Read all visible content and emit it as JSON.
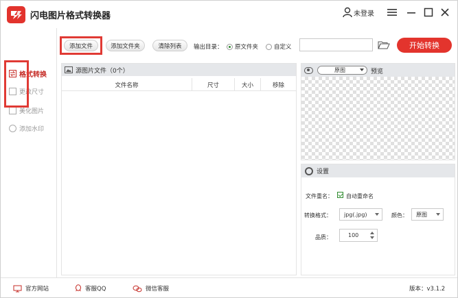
{
  "app": {
    "title": "闪电图片格式转换器",
    "user_label": "未登录"
  },
  "sidebar": {
    "items": [
      {
        "label": "格式转换",
        "icon": "convert-icon",
        "active": true
      },
      {
        "label": "更改尺寸",
        "icon": "resize-icon",
        "active": false
      },
      {
        "label": "美化图片",
        "icon": "beautify-icon",
        "active": false
      },
      {
        "label": "添加水印",
        "icon": "watermark-icon",
        "active": false
      }
    ]
  },
  "toolbar": {
    "add_file": "添加文件",
    "add_folder": "添加文件夹",
    "clear_list": "清除列表",
    "output_label": "输出目录：",
    "radio_source": "原文件夹",
    "radio_custom": "自定义",
    "output_path": "",
    "start": "开始转换"
  },
  "file_panel": {
    "title": "源图片文件（0个）",
    "columns": [
      "文件名称",
      "尺寸",
      "大小",
      "移除"
    ]
  },
  "preview": {
    "mode": "原图",
    "label": "预览"
  },
  "settings": {
    "title": "设置",
    "rename_label": "文件重名：",
    "auto_rename": "自动重命名",
    "format_label": "转换格式：",
    "format_value": "jpg(.jpg)",
    "color_label": "颜色：",
    "color_value": "原图",
    "quality_label": "品质：",
    "quality_value": "100"
  },
  "footer": {
    "website": "官方网站",
    "qq": "客服QQ",
    "wechat": "微信客服",
    "version": "版本：v3.1.2"
  },
  "colors": {
    "accent": "#e3342d",
    "highlight": "#e03a34",
    "header_bg": "#e5e7ea"
  }
}
